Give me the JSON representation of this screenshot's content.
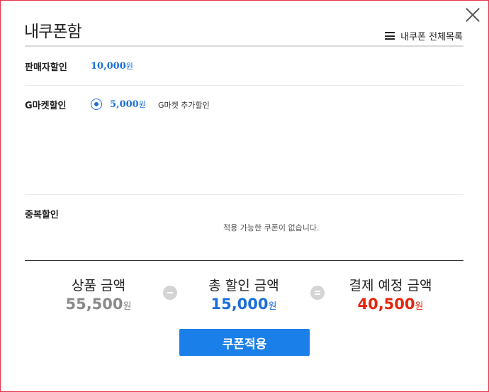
{
  "dialog": {
    "title": "내쿠폰함",
    "all_coupons_link": "내쿠폰 전체목록"
  },
  "seller_discount": {
    "label": "판매자할인",
    "amount": "10,000",
    "unit": "원"
  },
  "gmarket_discount": {
    "label": "G마켓할인",
    "option": {
      "selected": true,
      "amount": "5,000",
      "unit": "원",
      "description": "G마켓 추가할인"
    }
  },
  "duplicate_discount": {
    "label": "중복할인",
    "empty_message": "적용 가능한 쿠폰이 없습니다."
  },
  "summary": {
    "product_price": {
      "label": "상품 금액",
      "value": "55,500",
      "unit": "원",
      "color": "#8a8a8a"
    },
    "total_discount": {
      "label": "총 할인 금액",
      "value": "15,000",
      "unit": "원",
      "color": "#1a6fd8"
    },
    "payment_amount": {
      "label": "결제 예정 금액",
      "value": "40,500",
      "unit": "원",
      "color": "#e5260d"
    }
  },
  "apply_button": "쿠폰적용",
  "icons": {
    "close": "close-icon",
    "list": "hamburger-icon",
    "minus": "minus-circle-icon",
    "equals": "equals-circle-icon"
  },
  "colors": {
    "accent": "#1a7fe8",
    "dialog_border": "#e8344e"
  }
}
